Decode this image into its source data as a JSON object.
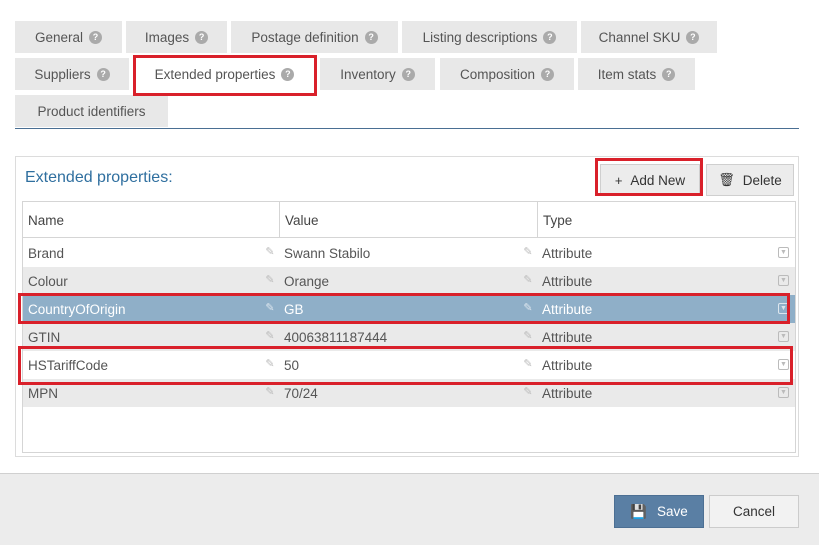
{
  "tabs": [
    {
      "label": "General",
      "help": true
    },
    {
      "label": "Images",
      "help": true
    },
    {
      "label": "Postage definition",
      "help": true
    },
    {
      "label": "Listing descriptions",
      "help": true
    },
    {
      "label": "Channel SKU",
      "help": true
    },
    {
      "label": "Suppliers",
      "help": true
    },
    {
      "label": "Extended properties",
      "help": true,
      "active": true
    },
    {
      "label": "Inventory",
      "help": true
    },
    {
      "label": "Composition",
      "help": true
    },
    {
      "label": "Item stats",
      "help": true
    },
    {
      "label": "Product identifiers",
      "help": false
    }
  ],
  "help_glyph": "?",
  "panel": {
    "title": "Extended properties:",
    "add_button": {
      "label": "Add New",
      "icon": "plus-icon",
      "glyph": "+"
    },
    "delete_button": {
      "label": "Delete",
      "icon": "trash-icon",
      "glyph": "🗑"
    }
  },
  "grid": {
    "columns": [
      "Name",
      "Value",
      "Type"
    ],
    "edit_glyph": "✎",
    "dropdown_glyph": "▼",
    "rows": [
      {
        "name": "Brand",
        "value": "Swann Stabilo",
        "type": "Attribute",
        "selected": false
      },
      {
        "name": "Colour",
        "value": "Orange",
        "type": "Attribute",
        "selected": false
      },
      {
        "name": "CountryOfOrigin",
        "value": "GB",
        "type": "Attribute",
        "selected": true
      },
      {
        "name": "GTIN",
        "value": "40063811187444",
        "type": "Attribute",
        "selected": false
      },
      {
        "name": "HSTariffCode",
        "value": "50",
        "type": "Attribute",
        "selected": false
      },
      {
        "name": "MPN",
        "value": "70/24",
        "type": "Attribute",
        "selected": false
      }
    ]
  },
  "footer": {
    "save_label": "Save",
    "save_glyph": "💾",
    "cancel_label": "Cancel"
  },
  "colors": {
    "accent": "#2f6f9f",
    "selected_row": "#8fafc8",
    "save_button": "#5a7fa4",
    "highlight": "#d9202a"
  }
}
